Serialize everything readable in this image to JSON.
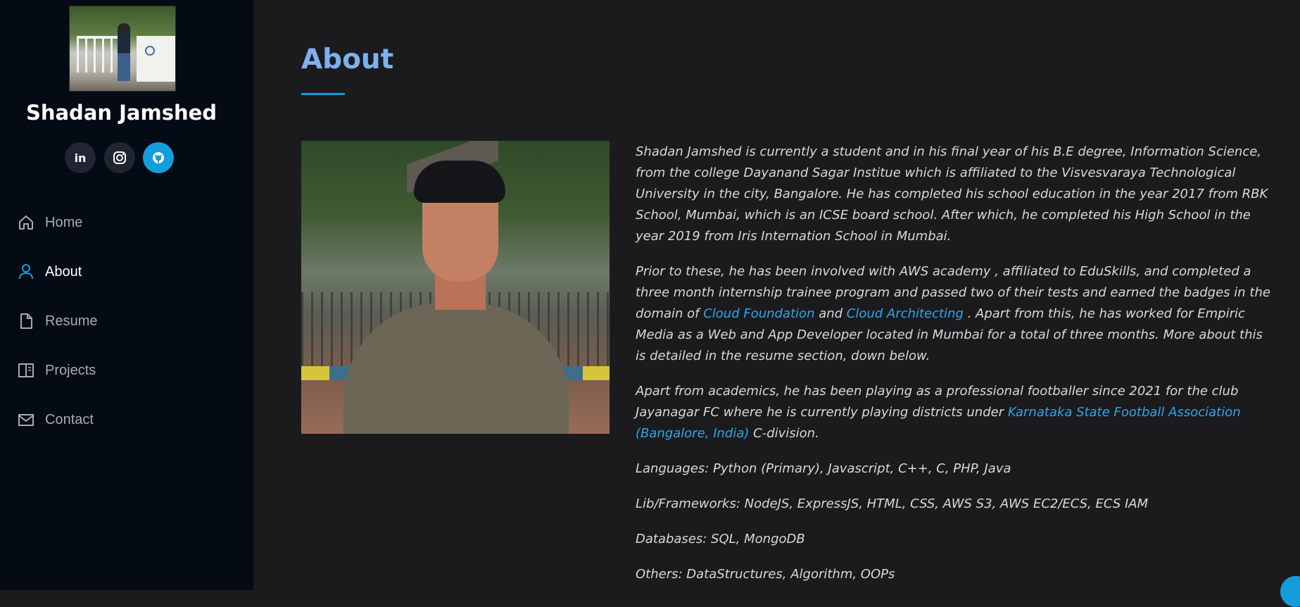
{
  "sidebar": {
    "name": "Shadan Jamshed",
    "social": [
      {
        "label": "in",
        "icon": "linkedin-icon"
      },
      {
        "label": "◎",
        "icon": "instagram-icon"
      },
      {
        "label": "◉",
        "icon": "github-icon"
      }
    ],
    "nav": [
      {
        "label": "Home",
        "icon": "home-icon",
        "active": false
      },
      {
        "label": "About",
        "icon": "person-icon",
        "active": true
      },
      {
        "label": "Resume",
        "icon": "file-icon",
        "active": false
      },
      {
        "label": "Projects",
        "icon": "book-icon",
        "active": false
      },
      {
        "label": "Contact",
        "icon": "envelope-icon",
        "active": false
      }
    ]
  },
  "main": {
    "title": "About",
    "paragraphs": {
      "p1": "Shadan Jamshed is currently a student and in his final year of his B.E degree, Information Science, from the college Dayanand Sagar Institue which is affiliated to the Visvesvaraya Technological University in the city, Bangalore. He has completed his school education in the year 2017 from RBK School, Mumbai, which is an ICSE board school. After which, he completed his High School in the year 2019 from Iris Internation School in Mumbai.",
      "p2_start": "Prior to these, he has been involved with AWS academy , affiliated to EduSkills, and completed a three month internship trainee program and passed two of their tests and earned the badges in the domain of ",
      "p2_link1": "Cloud Foundation",
      "p2_mid": " and ",
      "p2_link2": "Cloud Architecting",
      "p2_end": " . Apart from this, he has worked for Empiric Media as a Web and App Developer located in Mumbai for a total of three months. More about this is detailed in the resume section, down below.",
      "p3_start": "Apart from academics, he has been playing as a professional footballer since 2021 for the club Jayanagar FC where he is currently playing districts under ",
      "p3_link": "Karnataka State Football Association (Bangalore, India)",
      "p3_end": " C-division.",
      "languages": "Languages: Python (Primary), Javascript, C++, C, PHP, Java",
      "frameworks": "Lib/Frameworks: NodeJS, ExpressJS, HTML, CSS, AWS S3, AWS EC2/ECS, ECS IAM",
      "databases": "Databases: SQL, MongoDB",
      "others": "Others: DataStructures, Algorithm, OOPs"
    }
  },
  "colors": {
    "accent": "#149ddd",
    "title": "#7eb0f0",
    "link": "#2aa7f0",
    "sidebar_bg": "#040b14",
    "main_bg": "#1b1b1d"
  }
}
